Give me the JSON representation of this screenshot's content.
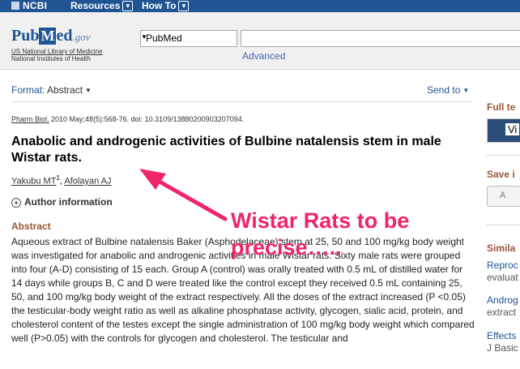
{
  "ncbi_bar": {
    "logo": "NCBI",
    "resources": "Resources",
    "howto": "How To"
  },
  "header": {
    "logo_pub": "Pub",
    "logo_m": "M",
    "logo_ed": "ed",
    "logo_gov": ".gov",
    "nlm_line1": "US National Library of Medicine",
    "nlm_line2": "National Institutes of Health",
    "db_selected": "PubMed",
    "search_value": "",
    "advanced": "Advanced"
  },
  "toolbar": {
    "format_label": "Format:",
    "format_value": "Abstract",
    "send_to": "Send to"
  },
  "article": {
    "journal": "Pharm Biol.",
    "citation_rest": " 2010 May;48(5):568-76. doi: 10.3109/13880200903207094.",
    "title": "Anabolic and androgenic activities of Bulbine natalensis stem in male Wistar rats.",
    "author1": "Yakubu MT",
    "author1_sup": "1",
    "author2": "Afolayan AJ",
    "author_info": "Author information",
    "abstract_heading": "Abstract",
    "abstract_text": "Aqueous extract of Bulbine natalensis Baker (Asphodelaceae) stem at 25, 50 and 100 mg/kg body weight was investigated for anabolic and androgenic activities in male Wistar rats. Sixty male rats were grouped into four (A-D) consisting of 15 each. Group A (control) was orally treated with 0.5 mL of distilled water for 14 days while groups B, C and D were treated like the control except they received 0.5 mL containing 25, 50, and 100 mg/kg body weight of the extract respectively. All the doses of the extract increased (P <0.05) the testicular-body weight ratio as well as alkaline phosphatase activity, glycogen, sialic acid, protein, and cholesterol content of the testes except the single administration of 100 mg/kg body weight which compared well (P>0.05) with the controls for glycogen and cholesterol. The testicular and"
  },
  "sidebar": {
    "full_text": "Full te",
    "badge_text": "Vi",
    "save": "Save i",
    "save_btn": "A",
    "similar": "Simila",
    "items": [
      {
        "title": "Reproc",
        "sub": "evaluat"
      },
      {
        "title": "Androg",
        "sub": "extract"
      },
      {
        "title": "Effects",
        "sub": "J Basic"
      }
    ]
  },
  "annotation": {
    "line1": "Wistar Rats to be",
    "line2": "precise….."
  },
  "colors": {
    "ncbi_bar": "#205493",
    "annotation": "#f0246a",
    "section_heading": "#985735",
    "link": "#205493"
  }
}
